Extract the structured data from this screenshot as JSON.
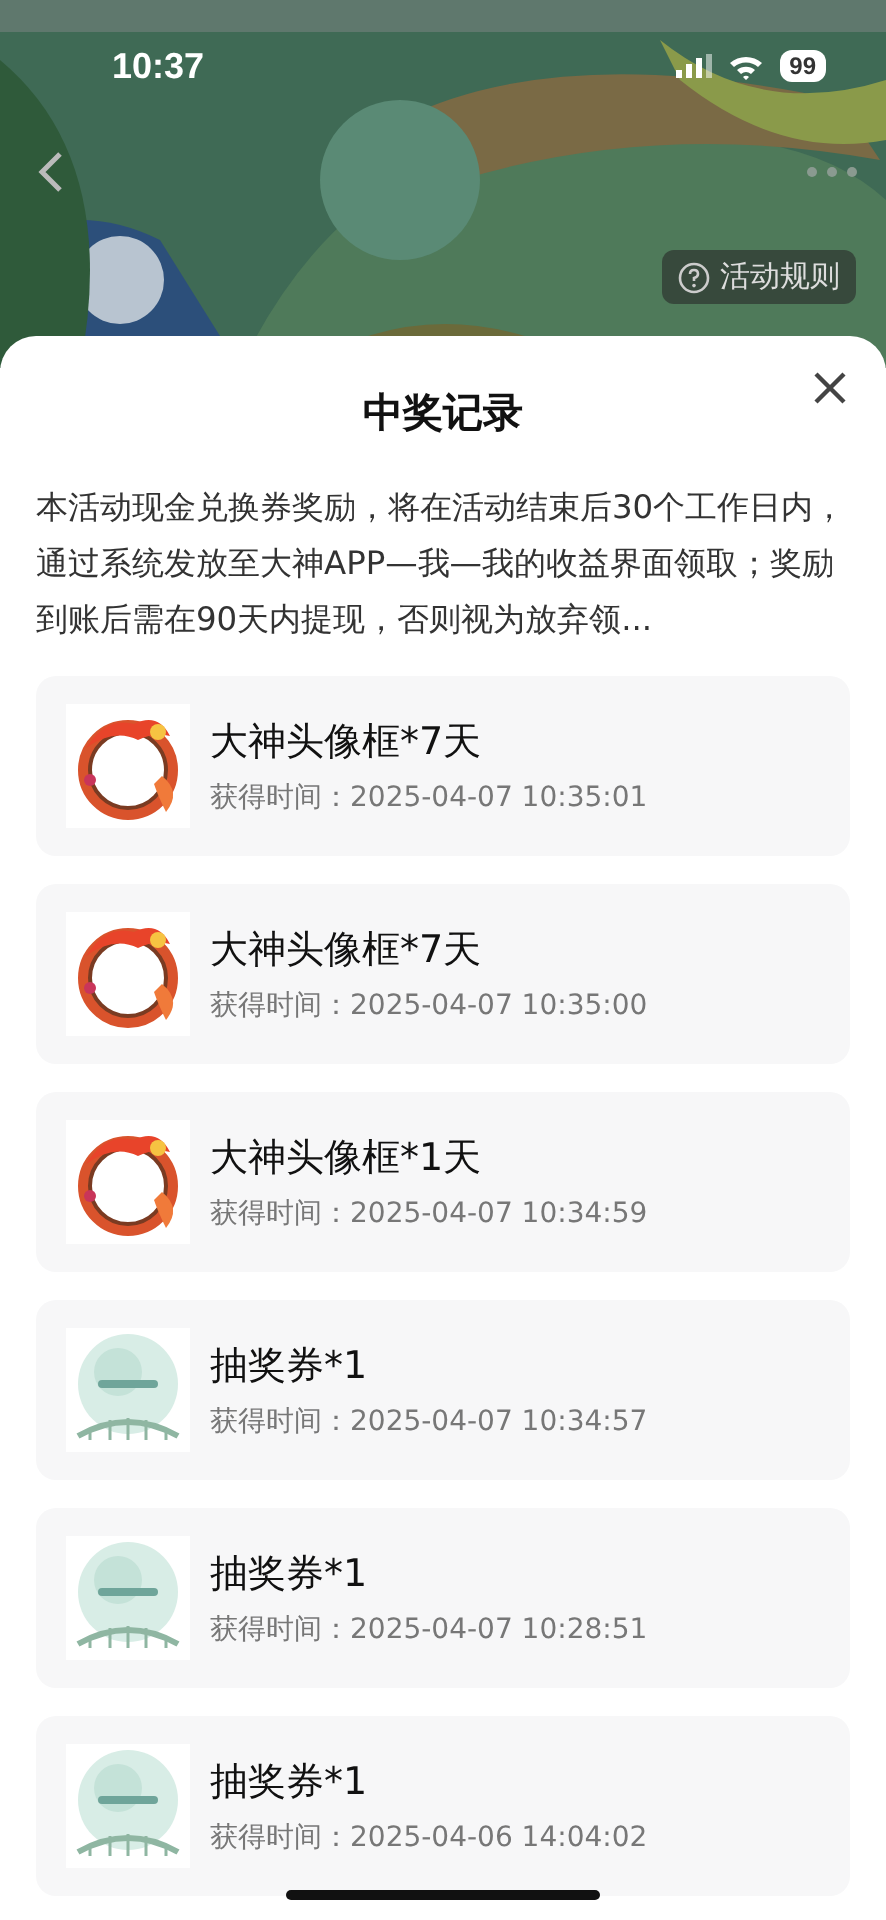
{
  "status_bar": {
    "time": "10:37",
    "battery": "99"
  },
  "banner": {
    "rules_button": "活动规则"
  },
  "sheet": {
    "title": "中奖记录",
    "notice": "本活动现金兑换券奖励，将在活动结束后30个工作日内，通过系统发放至大神APP—我—我的收益界面领取；奖励到账后需在90天内提现，否则视为放弃领...",
    "records": [
      {
        "kind": "avatar_frame",
        "name": "大神头像框*7天",
        "time": "获得时间：2025-04-07 10:35:01"
      },
      {
        "kind": "avatar_frame",
        "name": "大神头像框*7天",
        "time": "获得时间：2025-04-07 10:35:00"
      },
      {
        "kind": "avatar_frame",
        "name": "大神头像框*1天",
        "time": "获得时间：2025-04-07 10:34:59"
      },
      {
        "kind": "ticket",
        "name": "抽奖券*1",
        "time": "获得时间：2025-04-07 10:34:57"
      },
      {
        "kind": "ticket",
        "name": "抽奖券*1",
        "time": "获得时间：2025-04-07 10:28:51"
      },
      {
        "kind": "ticket",
        "name": "抽奖券*1",
        "time": "获得时间：2025-04-06 14:04:02"
      }
    ]
  }
}
